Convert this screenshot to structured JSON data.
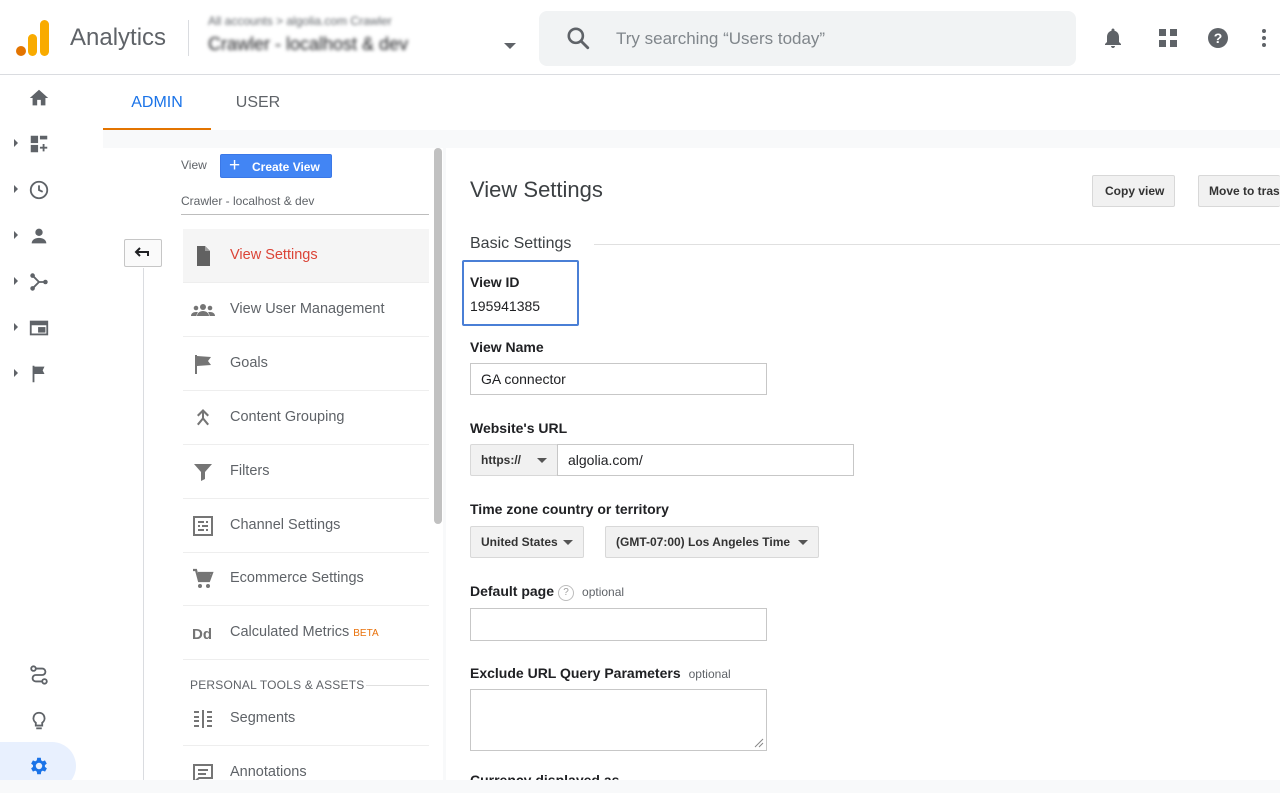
{
  "header": {
    "app_title": "Analytics",
    "account_breadcrumb": "All accounts > algolia.com Crawler",
    "account_property": "Crawler - localhost & dev",
    "search_placeholder": "Try searching “Users today”"
  },
  "colors": {
    "accent_blue": "#1a73e8",
    "tab_underline": "#e37400",
    "active_nav_text": "#db4437",
    "create_view_button": "#4285f4",
    "view_id_highlight": "#4a7fd6"
  },
  "rail": {
    "icons": [
      "home-icon",
      "dashboards-icon",
      "realtime-icon",
      "audience-icon",
      "acquisition-icon",
      "behavior-icon",
      "conversions-icon",
      "attribution-icon",
      "insights-icon",
      "admin-gear-icon"
    ]
  },
  "tabs": [
    {
      "label": "ADMIN",
      "active": true
    },
    {
      "label": "USER",
      "active": false
    }
  ],
  "left_nav": {
    "view_label": "View",
    "create_view_label": "Create View",
    "current_view": "Crawler - localhost & dev",
    "items": [
      {
        "label": "View Settings",
        "icon": "document-icon",
        "active": true
      },
      {
        "label": "View User Management",
        "icon": "people-icon"
      },
      {
        "label": "Goals",
        "icon": "flag-icon"
      },
      {
        "label": "Content Grouping",
        "icon": "grouping-icon"
      },
      {
        "label": "Filters",
        "icon": "filter-icon"
      },
      {
        "label": "Channel Settings",
        "icon": "channel-icon"
      },
      {
        "label": "Ecommerce Settings",
        "icon": "cart-icon"
      },
      {
        "label": "Calculated Metrics",
        "icon": "dd-icon",
        "badge": "BETA"
      }
    ],
    "section_heading": "PERSONAL TOOLS & ASSETS",
    "personal_items": [
      {
        "label": "Segments",
        "icon": "segments-icon"
      },
      {
        "label": "Annotations",
        "icon": "annotations-icon"
      }
    ]
  },
  "main": {
    "title": "View Settings",
    "copy_view_label": "Copy view",
    "move_to_trash_label": "Move to trash",
    "basic_settings_title": "Basic Settings",
    "view_id_label": "View ID",
    "view_id_value": "195941385",
    "view_name_label": "View Name",
    "view_name_value": "GA connector",
    "website_url_label": "Website's URL",
    "protocol_value": "https://",
    "website_url_value": "algolia.com/",
    "timezone_label": "Time zone country or territory",
    "country_value": "United States",
    "timezone_value": "(GMT-07:00) Los Angeles Time",
    "default_page_label": "Default page",
    "help_glyph": "?",
    "optional_text": "optional",
    "default_page_value": "",
    "exclude_params_label": "Exclude URL Query Parameters",
    "exclude_params_value": "",
    "next_label": "Currency displayed as"
  }
}
